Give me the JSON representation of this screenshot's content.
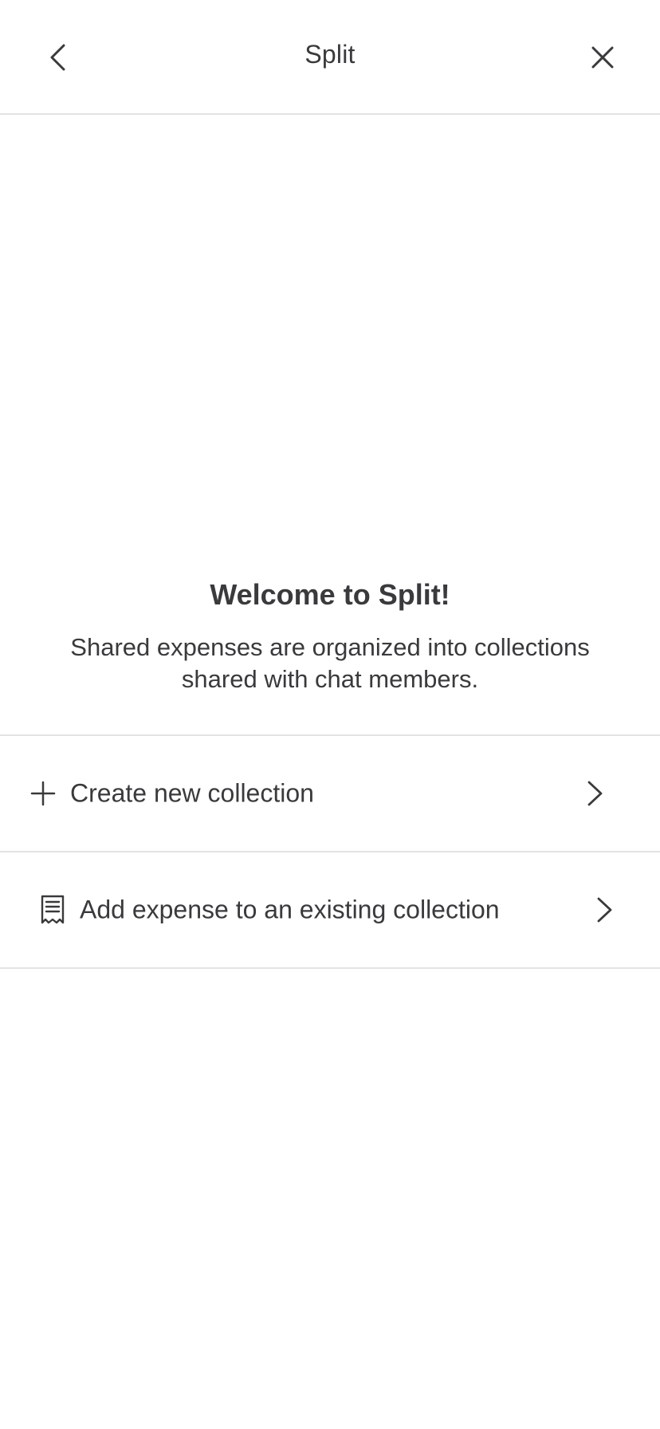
{
  "header": {
    "title": "Split"
  },
  "welcome": {
    "heading": "Welcome to Split!",
    "description": "Shared expenses are organized into collections shared with chat members."
  },
  "options": [
    {
      "label": "Create new collection",
      "icon": "plus-icon"
    },
    {
      "label": "Add expense to an existing collection",
      "icon": "receipt-icon"
    }
  ],
  "colors": {
    "text": "#3a3a3c",
    "divider": "#e3e3e3",
    "background": "#ffffff"
  }
}
